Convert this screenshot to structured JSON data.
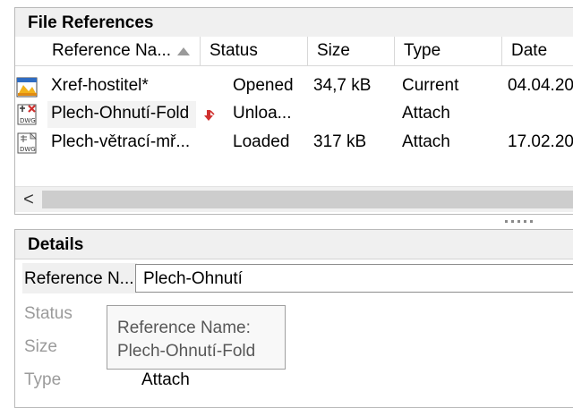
{
  "file_references": {
    "title": "File References",
    "columns": {
      "reference_name": "Reference Na...",
      "status": "Status",
      "size": "Size",
      "type": "Type",
      "date": "Date"
    },
    "sorted_column": "Reference Name",
    "sort_direction": "ascending",
    "rows": [
      {
        "name": "Xref-hostitel*",
        "status": "Opened",
        "size": "34,7 kB",
        "type": "Current",
        "date": "04.04.20",
        "icon": "drawing-current-icon"
      },
      {
        "name": "Plech-Ohnutí-Fold",
        "status": "Unloa...",
        "size": "",
        "type": "Attach",
        "date": "",
        "icon": "dwg-unloaded-icon",
        "status_icon": "unloaded-arrow-icon"
      },
      {
        "name": "Plech-větrací-mř...",
        "status": "Loaded",
        "size": "317 kB",
        "type": "Attach",
        "date": "17.02.20",
        "icon": "dwg-file-icon"
      }
    ],
    "scroll_left_glyph": "<"
  },
  "details": {
    "title": "Details",
    "reference_name_label": "Reference N...",
    "reference_name_value": "Plech-Ohnutí",
    "status_label": "Status",
    "size_label": "Size",
    "type_label": "Type",
    "type_value": "Attach",
    "tooltip": {
      "line1": "Reference Name:",
      "line2": "Plech-Ohnutí-Fold"
    }
  },
  "colors": {
    "header_bg": "#f0f0f0",
    "border": "#b9b9b9",
    "unloaded_arrow": "#d0302f",
    "muted_label": "#9b9b9b"
  }
}
